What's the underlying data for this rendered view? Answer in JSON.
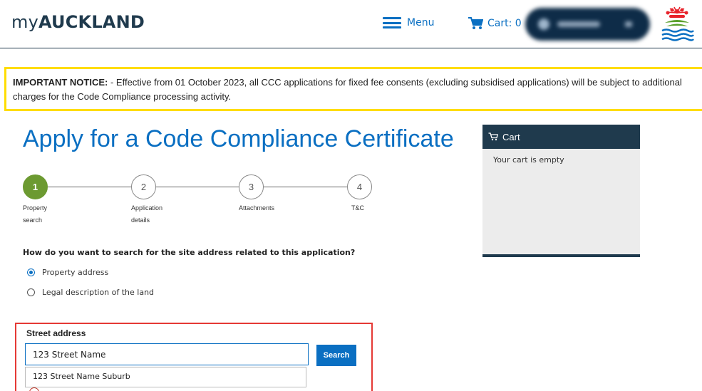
{
  "header": {
    "logo_prefix": "my",
    "logo_bold": "AUCKLAND",
    "menu_label": "Menu",
    "cart_label": "Cart: 0"
  },
  "notice": {
    "label": "IMPORTANT NOTICE:",
    "text": " - Effective from 01 October 2023, all CCC applications for fixed fee consents (excluding subsidised applications) will be subject to additional charges for the Code Compliance processing activity."
  },
  "page_title": "Apply for a Code Compliance Certificate",
  "stepper": {
    "steps": [
      {
        "number": "1",
        "label_line1": "Property",
        "label_line2": "search",
        "active": true
      },
      {
        "number": "2",
        "label_line1": "Application",
        "label_line2": "details",
        "active": false
      },
      {
        "number": "3",
        "label_line1": "Attachments",
        "label_line2": "",
        "active": false
      },
      {
        "number": "4",
        "label_line1": "T&C",
        "label_line2": "",
        "active": false
      }
    ]
  },
  "search": {
    "question": "How do you want to search for the site address related to this application?",
    "options": [
      {
        "label": "Property address",
        "checked": true
      },
      {
        "label": "Legal description of the land",
        "checked": false
      }
    ],
    "street_label": "Street address",
    "street_value": "123 Street Name",
    "search_button": "Search",
    "suggestion": "123 Street Name Suburb"
  },
  "cart": {
    "title": "Cart",
    "empty_text": "Your cart is empty"
  },
  "colors": {
    "brand_blue": "#0a6fc2",
    "navy": "#1f3a4d",
    "step_active": "#6c9a31",
    "notice_border": "#ffdd00",
    "highlight_border": "#e53935"
  }
}
